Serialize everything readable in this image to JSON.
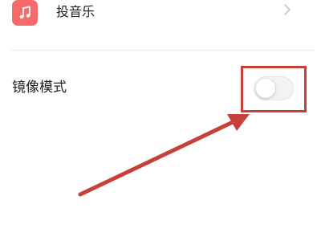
{
  "settings": {
    "music": {
      "label": "投音乐",
      "icon": "music-note-icon",
      "icon_bg": "#f56b6b"
    },
    "mirror": {
      "label": "镜像模式",
      "toggle_on": false
    }
  },
  "annotation": {
    "color": "#c8403a"
  }
}
